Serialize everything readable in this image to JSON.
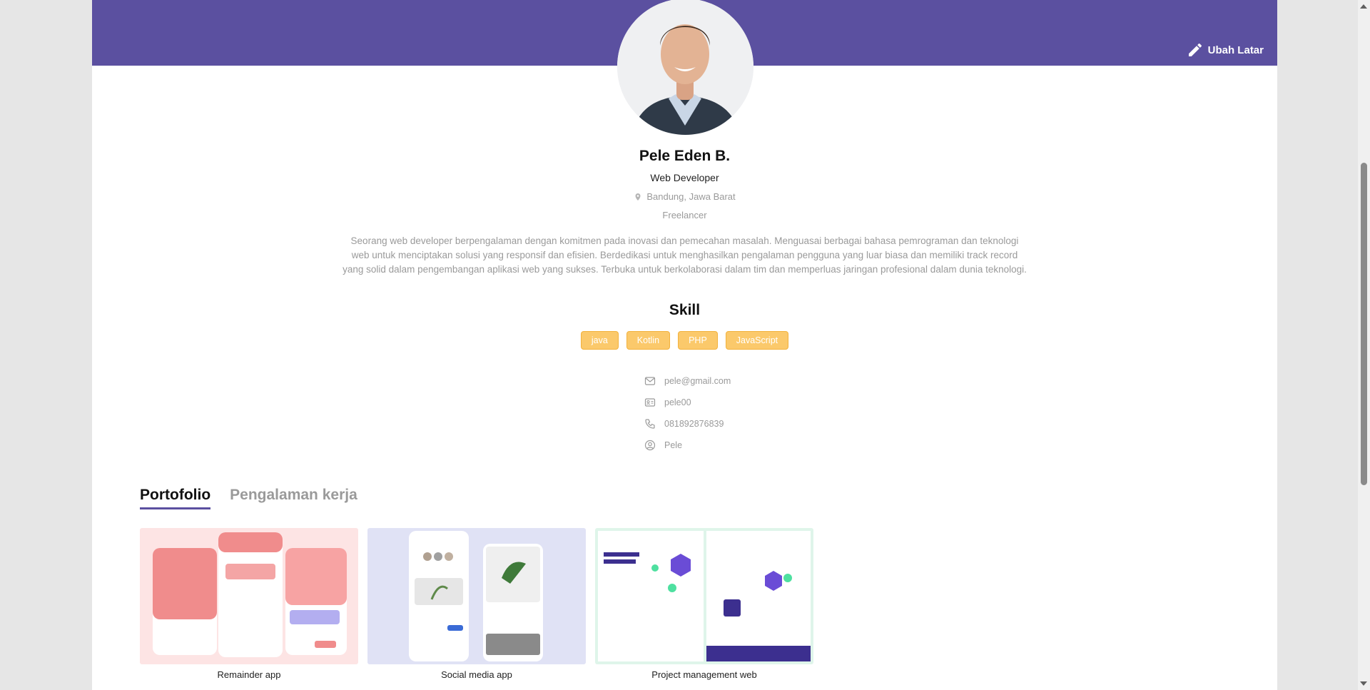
{
  "colors": {
    "accent": "#5b50a0",
    "chip": "#fbc96b"
  },
  "header": {
    "edit_background_label": "Ubah Latar",
    "edit_icon": "pencil-icon"
  },
  "profile": {
    "name": "Pele Eden B.",
    "job_title": "Web Developer",
    "location": "Bandung, Jawa Barat",
    "work_status": "Freelancer",
    "bio": "Seorang web developer berpengalaman dengan komitmen pada inovasi dan pemecahan masalah. Menguasai berbagai bahasa pemrograman dan teknologi web untuk menciptakan solusi yang responsif dan efisien. Berdedikasi untuk menghasilkan pengalaman pengguna yang luar biasa dan memiliki track record yang solid dalam pengembangan aplikasi web yang sukses. Terbuka untuk berkolaborasi dalam tim dan memperluas jaringan profesional dalam dunia teknologi."
  },
  "skills": {
    "title": "Skill",
    "items": [
      "java",
      "Kotlin",
      "PHP",
      "JavaScript"
    ]
  },
  "contacts": [
    {
      "icon": "mail-icon",
      "value": "pele@gmail.com"
    },
    {
      "icon": "id-card-icon",
      "value": "pele00"
    },
    {
      "icon": "phone-icon",
      "value": "081892876839"
    },
    {
      "icon": "user-circle-icon",
      "value": "Pele"
    }
  ],
  "tabs": [
    {
      "label": "Portofolio",
      "active": true
    },
    {
      "label": "Pengalaman kerja",
      "active": false
    }
  ],
  "portfolio": [
    {
      "label": "Remainder app"
    },
    {
      "label": "Social media app"
    },
    {
      "label": "Project management web"
    }
  ]
}
